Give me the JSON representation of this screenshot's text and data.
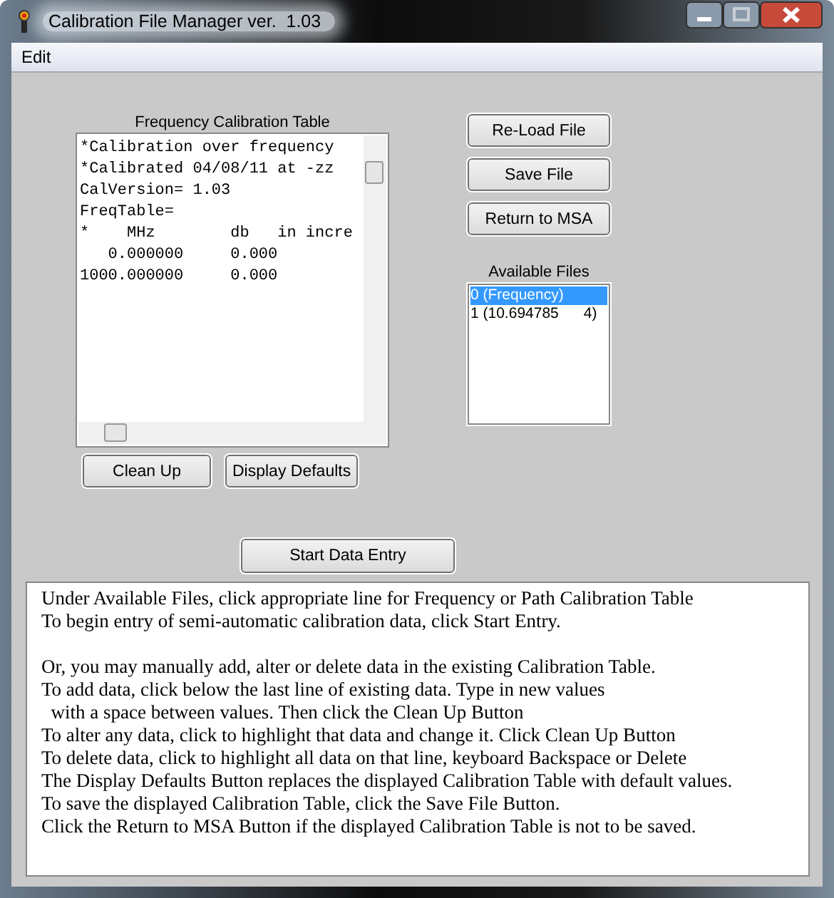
{
  "window": {
    "title": "Calibration File Manager ver.  1.03"
  },
  "menu": [
    "Edit"
  ],
  "table_editor": {
    "label": "Frequency Calibration Table",
    "lines": [
      "*Calibration over frequency",
      "*Calibrated 04/08/11 at -zz",
      "CalVersion= 1.03",
      "FreqTable=",
      "*    MHz        db   in incre",
      "   0.000000     0.000",
      "1000.000000     0.000"
    ]
  },
  "editor_buttons": [
    "Clean Up",
    "Display Defaults"
  ],
  "file_buttons": [
    "Re-Load File",
    "Save File",
    "Return to MSA"
  ],
  "available_files": {
    "label": "Available Files",
    "items": [
      {
        "text": "0 (Frequency)",
        "selected": true
      },
      {
        "text": "1 (10.694785      4)",
        "selected": false
      }
    ]
  },
  "start_button": "Start Data Entry",
  "instructions": [
    [
      "Under Available Files, click appropriate line for Frequency or Path Calibration Table",
      "To begin entry of semi-automatic calibration data, click Start Entry."
    ],
    [
      "Or, you may manually add, alter or delete data in the existing Calibration Table.",
      "To add data, click below the last line of existing data. Type in new values",
      "  with a space between values. Then click the Clean Up Button",
      "To alter any data, click to highlight that data and change it. Click Clean Up Button",
      "To delete data, click to highlight all data on that line, keyboard Backspace or Delete",
      "The Display Defaults Button replaces the displayed Calibration Table with default values.",
      "To save the displayed Calibration Table, click the Save File Button.",
      "Click the Return to MSA Button if the displayed Calibration Table is not to be saved."
    ]
  ]
}
